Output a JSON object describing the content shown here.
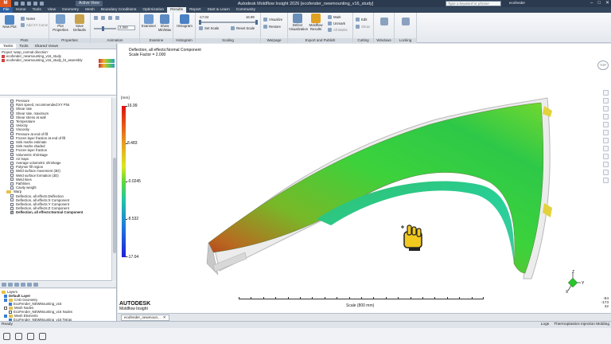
{
  "titlebar": {
    "logo": "M",
    "active_view": "Active View",
    "title": "Autodesk Moldflow Insight 2026   [ecofender_newmounting_v16_study]",
    "search_placeholder": "Type a keyword or phrase",
    "user": "ecofender",
    "min": "–",
    "max": "□",
    "close": "✕"
  },
  "menu": {
    "tabs": [
      "File",
      "Home",
      "Tools",
      "View",
      "Geometry",
      "Mesh",
      "Boundary Conditions",
      "Optimization",
      "Results",
      "Report",
      "Start & Learn",
      "Community"
    ]
  },
  "ribbon": {
    "new_plot": "New Plot",
    "notes": "Notes",
    "add_xy": "Add XY Curve",
    "plot_properties": "Plot Properties",
    "save_defaults": "Save Defaults",
    "animation_value": "2.000",
    "examiner": "Examiner",
    "show_min_max": "Show Min/Max",
    "histogram": "Histogram",
    "scale_min": "-17.04",
    "scale_max": "16.99",
    "set_scale": "Set Scale",
    "reset_scale": "Reset Scale",
    "visualize": "Visualize",
    "restore": "Restore",
    "defect_visualization": "Defect Visualization",
    "moldflow_results": "Moldflow Results",
    "mark": "Mark",
    "unmark": "Unmark",
    "all_marks": "All Marks",
    "edit": "Edit",
    "show": "Show",
    "groups": [
      "Plots",
      "Properties",
      "Animation",
      "Examine",
      "Histogram",
      "Scaling",
      "Warpage",
      "Export and Publish",
      "Cutting Plane",
      "Windows",
      "Locking"
    ]
  },
  "left_panel": {
    "tabs": [
      "Tasks",
      "Tools",
      "Shared Views"
    ],
    "project_items": [
      "Project 'warp_normal direction'",
      "ecofender_newmounting_v16_study",
      "ecofender_newmounting_v16_study_bt_assembly"
    ],
    "results": [
      {
        "label": "Pressure",
        "checked": false,
        "folder": false
      },
      {
        "label": "Ram speed, recommended:XY Plot",
        "checked": false,
        "folder": false
      },
      {
        "label": "Shear rate",
        "checked": false,
        "folder": false
      },
      {
        "label": "Shear rate, maximum",
        "checked": false,
        "folder": false
      },
      {
        "label": "Shear stress at wall",
        "checked": false,
        "folder": false
      },
      {
        "label": "Temperature",
        "checked": false,
        "folder": false
      },
      {
        "label": "Velocity",
        "checked": false,
        "folder": false
      },
      {
        "label": "Viscosity",
        "checked": false,
        "folder": false
      },
      {
        "label": "Pressure at end of fill",
        "checked": false,
        "folder": false
      },
      {
        "label": "Frozen layer fraction at end of fill",
        "checked": false,
        "folder": false
      },
      {
        "label": "Sink marks estimate",
        "checked": false,
        "folder": false
      },
      {
        "label": "Sink marks shaded",
        "checked": false,
        "folder": false
      },
      {
        "label": "Frozen layer fraction",
        "checked": false,
        "folder": false
      },
      {
        "label": "Volumetric shrinkage",
        "checked": false,
        "folder": false
      },
      {
        "label": "Air traps",
        "checked": false,
        "folder": false
      },
      {
        "label": "Average volumetric shrinkage",
        "checked": false,
        "folder": false
      },
      {
        "label": "Polymer fill region",
        "checked": false,
        "folder": false
      },
      {
        "label": "Weld surface movement (3D)",
        "checked": false,
        "folder": false
      },
      {
        "label": "Weld surface formation (3D)",
        "checked": false,
        "folder": false
      },
      {
        "label": "Weld lines",
        "checked": false,
        "folder": false
      },
      {
        "label": "Pathlines",
        "checked": false,
        "folder": false
      },
      {
        "label": "Cavity weight",
        "checked": false,
        "folder": false
      },
      {
        "label": "Warp",
        "checked": false,
        "folder": true
      },
      {
        "label": "Deflection, all effects:Deflection",
        "checked": false,
        "folder": false
      },
      {
        "label": "Deflection, all effects:X Component",
        "checked": false,
        "folder": false
      },
      {
        "label": "Deflection, all effects:Y Component",
        "checked": false,
        "folder": false
      },
      {
        "label": "Deflection, all effects:Z Component",
        "checked": false,
        "folder": false
      },
      {
        "label": "Deflection, all effects:Normal Component",
        "checked": true,
        "folder": false
      }
    ],
    "layers": [
      "Layers",
      "Default Layer",
      "CAD Geometry",
      "EcoFender_NEWMounting_v16",
      "Mesh Nodes",
      "EcoFender_NEWMounting_v16 Nodes",
      "Mesh Elements",
      "EcoFender_NEWMounting_v16 Tetras"
    ]
  },
  "viewport": {
    "title_line1": "Deflection, all effects:Normal Component",
    "title_line2": "Scale Factor = 2.000",
    "unit": "[mm]",
    "legend": [
      "16.99",
      "8.483",
      "-0.0245",
      "-8.532",
      "-17.04"
    ],
    "brand": "AUTODESK",
    "brand_sub": "Moldflow Insight",
    "scale_label": "Scale (800 mm)",
    "viewcube": "TOP",
    "axes": {
      "x": "X",
      "y": "Y",
      "z": "Z"
    },
    "coords": [
      "-94",
      "-173",
      "42"
    ]
  },
  "doc_tab": {
    "label": "ecofender_newmoun...",
    "close": "✕"
  },
  "status": {
    "left": "Ready",
    "logs": "Logs",
    "process": "Thermoplastics Injection Molding"
  }
}
